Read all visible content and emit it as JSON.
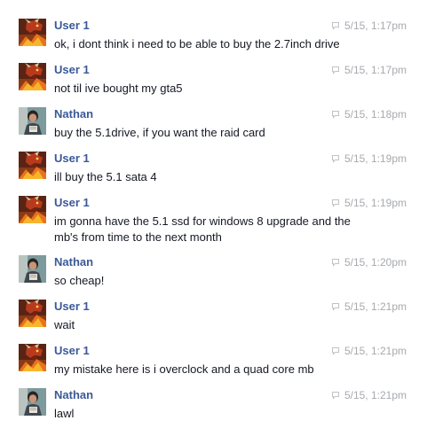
{
  "chat": {
    "messages": [
      {
        "sender": "User 1",
        "avatar": "dragon-avatar",
        "text": "ok, i dont think i need to be able to buy the 2.7inch drive",
        "time": "5/15, 1:17pm"
      },
      {
        "sender": "User 1",
        "avatar": "dragon-avatar",
        "text": "not til ive bought my gta5",
        "time": "5/15, 1:17pm"
      },
      {
        "sender": "Nathan",
        "avatar": "person-avatar",
        "text": "buy the 5.1drive, if you want the raid card",
        "time": "5/15, 1:18pm"
      },
      {
        "sender": "User 1",
        "avatar": "dragon-avatar",
        "text": "ill buy the 5.1 sata 4",
        "time": "5/15, 1:19pm"
      },
      {
        "sender": "User 1",
        "avatar": "dragon-avatar",
        "text": "im gonna have the 5.1 ssd for windows 8 upgrade and the mb's from time to the next month",
        "time": "5/15, 1:19pm"
      },
      {
        "sender": "Nathan",
        "avatar": "person-avatar",
        "text": "so cheap!",
        "time": "5/15, 1:20pm"
      },
      {
        "sender": "User 1",
        "avatar": "dragon-avatar",
        "text": "wait",
        "time": "5/15, 1:21pm"
      },
      {
        "sender": "User 1",
        "avatar": "dragon-avatar",
        "text": "my mistake here is i overclock and a quad core mb",
        "time": "5/15, 1:21pm"
      },
      {
        "sender": "Nathan",
        "avatar": "person-avatar",
        "text": "lawl",
        "time": "5/15, 1:21pm"
      }
    ]
  },
  "colors": {
    "sender_name": "#3b5998",
    "message_text": "#141823",
    "timestamp": "#a7a9ad"
  }
}
